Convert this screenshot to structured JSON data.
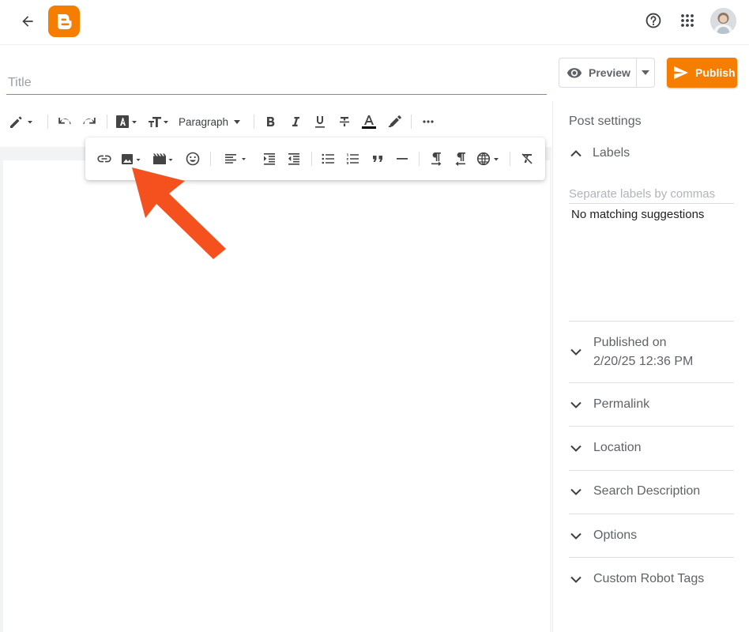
{
  "header": {
    "back_icon": "arrow-left-icon",
    "logo": "blogger-logo",
    "help_icon": "help-circle-icon",
    "apps_icon": "apps-grid-icon",
    "avatar": "user-avatar"
  },
  "post": {
    "title_placeholder": "Title",
    "title_value": ""
  },
  "actions": {
    "preview_label": "Preview",
    "publish_label": "Publish"
  },
  "toolbar": {
    "format_label": "Paragraph",
    "icons": [
      "pencil-icon",
      "undo-icon",
      "redo-icon",
      "font-icon",
      "text-size-icon",
      "bold-icon",
      "italic-icon",
      "underline-icon",
      "strikethrough-icon",
      "text-color-icon",
      "highlight-icon",
      "more-icon"
    ]
  },
  "floating_toolbar": {
    "icons": [
      "link-icon",
      "image-icon",
      "video-icon",
      "emoji-icon",
      "align-icon",
      "indent-increase-icon",
      "indent-decrease-icon",
      "bulleted-list-icon",
      "numbered-list-icon",
      "quote-icon",
      "horizontal-rule-icon",
      "ltr-icon",
      "rtl-icon",
      "language-icon",
      "clear-format-icon"
    ]
  },
  "annotation": {
    "arrow_color": "#f4511e",
    "target": "image-icon"
  },
  "sidebar": {
    "heading": "Post settings",
    "labels": {
      "title": "Labels",
      "input_placeholder": "Separate labels by commas",
      "suggestion": "No matching suggestions"
    },
    "published_on": {
      "title": "Published on",
      "value": "2/20/25 12:36 PM"
    },
    "sections": [
      "Permalink",
      "Location",
      "Search Description",
      "Options",
      "Custom Robot Tags"
    ]
  },
  "colors": {
    "brand": "#f57d00",
    "title_underline": "#e8710a",
    "text": "#3c4043",
    "muted": "#5f6368"
  }
}
